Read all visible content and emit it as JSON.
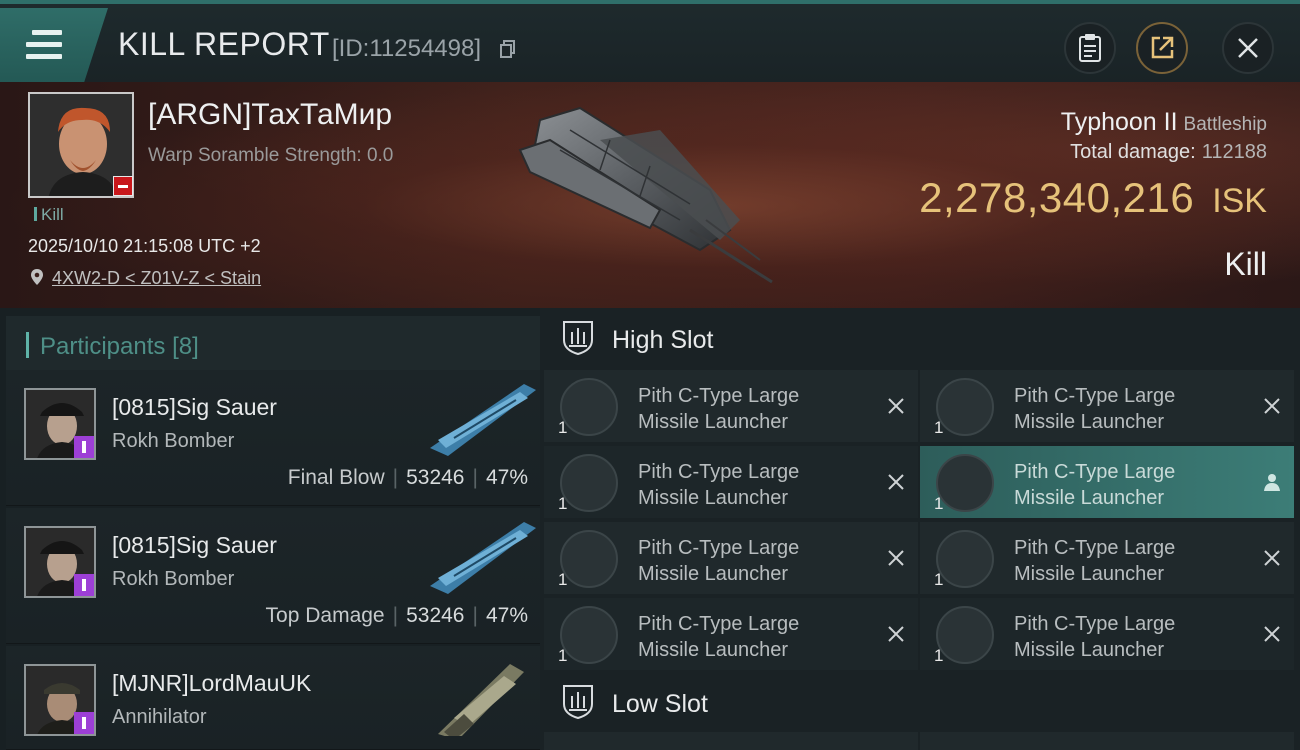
{
  "header": {
    "title": "KILL REPORT",
    "report_id": "[ID:11254498]"
  },
  "victim": {
    "name": "[ARGN]ТахТаМир",
    "scramble": "Warp Soramble Strength: 0.0",
    "result_tag": "Kill",
    "timestamp": "2025/10/10 21:15:08 UTC +2",
    "location": "4XW2-D < Z01V-Z < Stain",
    "ship_name": "Typhoon II",
    "ship_class": "Battleship",
    "total_damage_label": "Total damage:",
    "total_damage": "112188",
    "isk_value": "2,278,340,216",
    "isk_unit": "ISK",
    "result_label": "Kill"
  },
  "participants": {
    "title": "Participants",
    "count": "[8]",
    "items": [
      {
        "name": "[0815]Sig Sauer",
        "ship": "Rokh Bomber",
        "role": "Final Blow",
        "damage": "53246",
        "percent": "47%"
      },
      {
        "name": "[0815]Sig Sauer",
        "ship": "Rokh Bomber",
        "role": "Top Damage",
        "damage": "53246",
        "percent": "47%"
      },
      {
        "name": "[MJNR]LordMauUK",
        "ship": "Annihilator",
        "role": "",
        "damage": "",
        "percent": ""
      }
    ]
  },
  "slots": {
    "high_title": "High Slot",
    "low_title": "Low Slot",
    "high_modules": [
      {
        "line1": "Pith C-Type Large",
        "line2": "Missile Launcher",
        "qty": "1",
        "state": "destroyed"
      },
      {
        "line1": "Pith C-Type Large",
        "line2": "Missile Launcher",
        "qty": "1",
        "state": "destroyed"
      },
      {
        "line1": "Pith C-Type Large",
        "line2": "Missile Launcher",
        "qty": "1",
        "state": "destroyed"
      },
      {
        "line1": "Pith C-Type Large",
        "line2": "Missile Launcher",
        "qty": "1",
        "state": "dropped"
      },
      {
        "line1": "Pith C-Type Large",
        "line2": "Missile Launcher",
        "qty": "1",
        "state": "destroyed"
      },
      {
        "line1": "Pith C-Type Large",
        "line2": "Missile Launcher",
        "qty": "1",
        "state": "destroyed"
      },
      {
        "line1": "Pith C-Type Large",
        "line2": "Missile Launcher",
        "qty": "1",
        "state": "destroyed"
      },
      {
        "line1": "Pith C-Type Large",
        "line2": "Missile Launcher",
        "qty": "1",
        "state": "destroyed"
      }
    ]
  },
  "colors": {
    "accent_teal": "#2f6d68",
    "isk_gold": "#e6c27a",
    "badge_purple": "#9d3fd6",
    "badge_red": "#c8171b"
  },
  "icons": {
    "menu": "hamburger-icon",
    "copy": "copy-icon",
    "report": "clipboard-icon",
    "share": "share-icon",
    "close": "close-icon",
    "location": "location-pin-icon",
    "high_slot": "high-slot-icon",
    "low_slot": "low-slot-icon"
  }
}
